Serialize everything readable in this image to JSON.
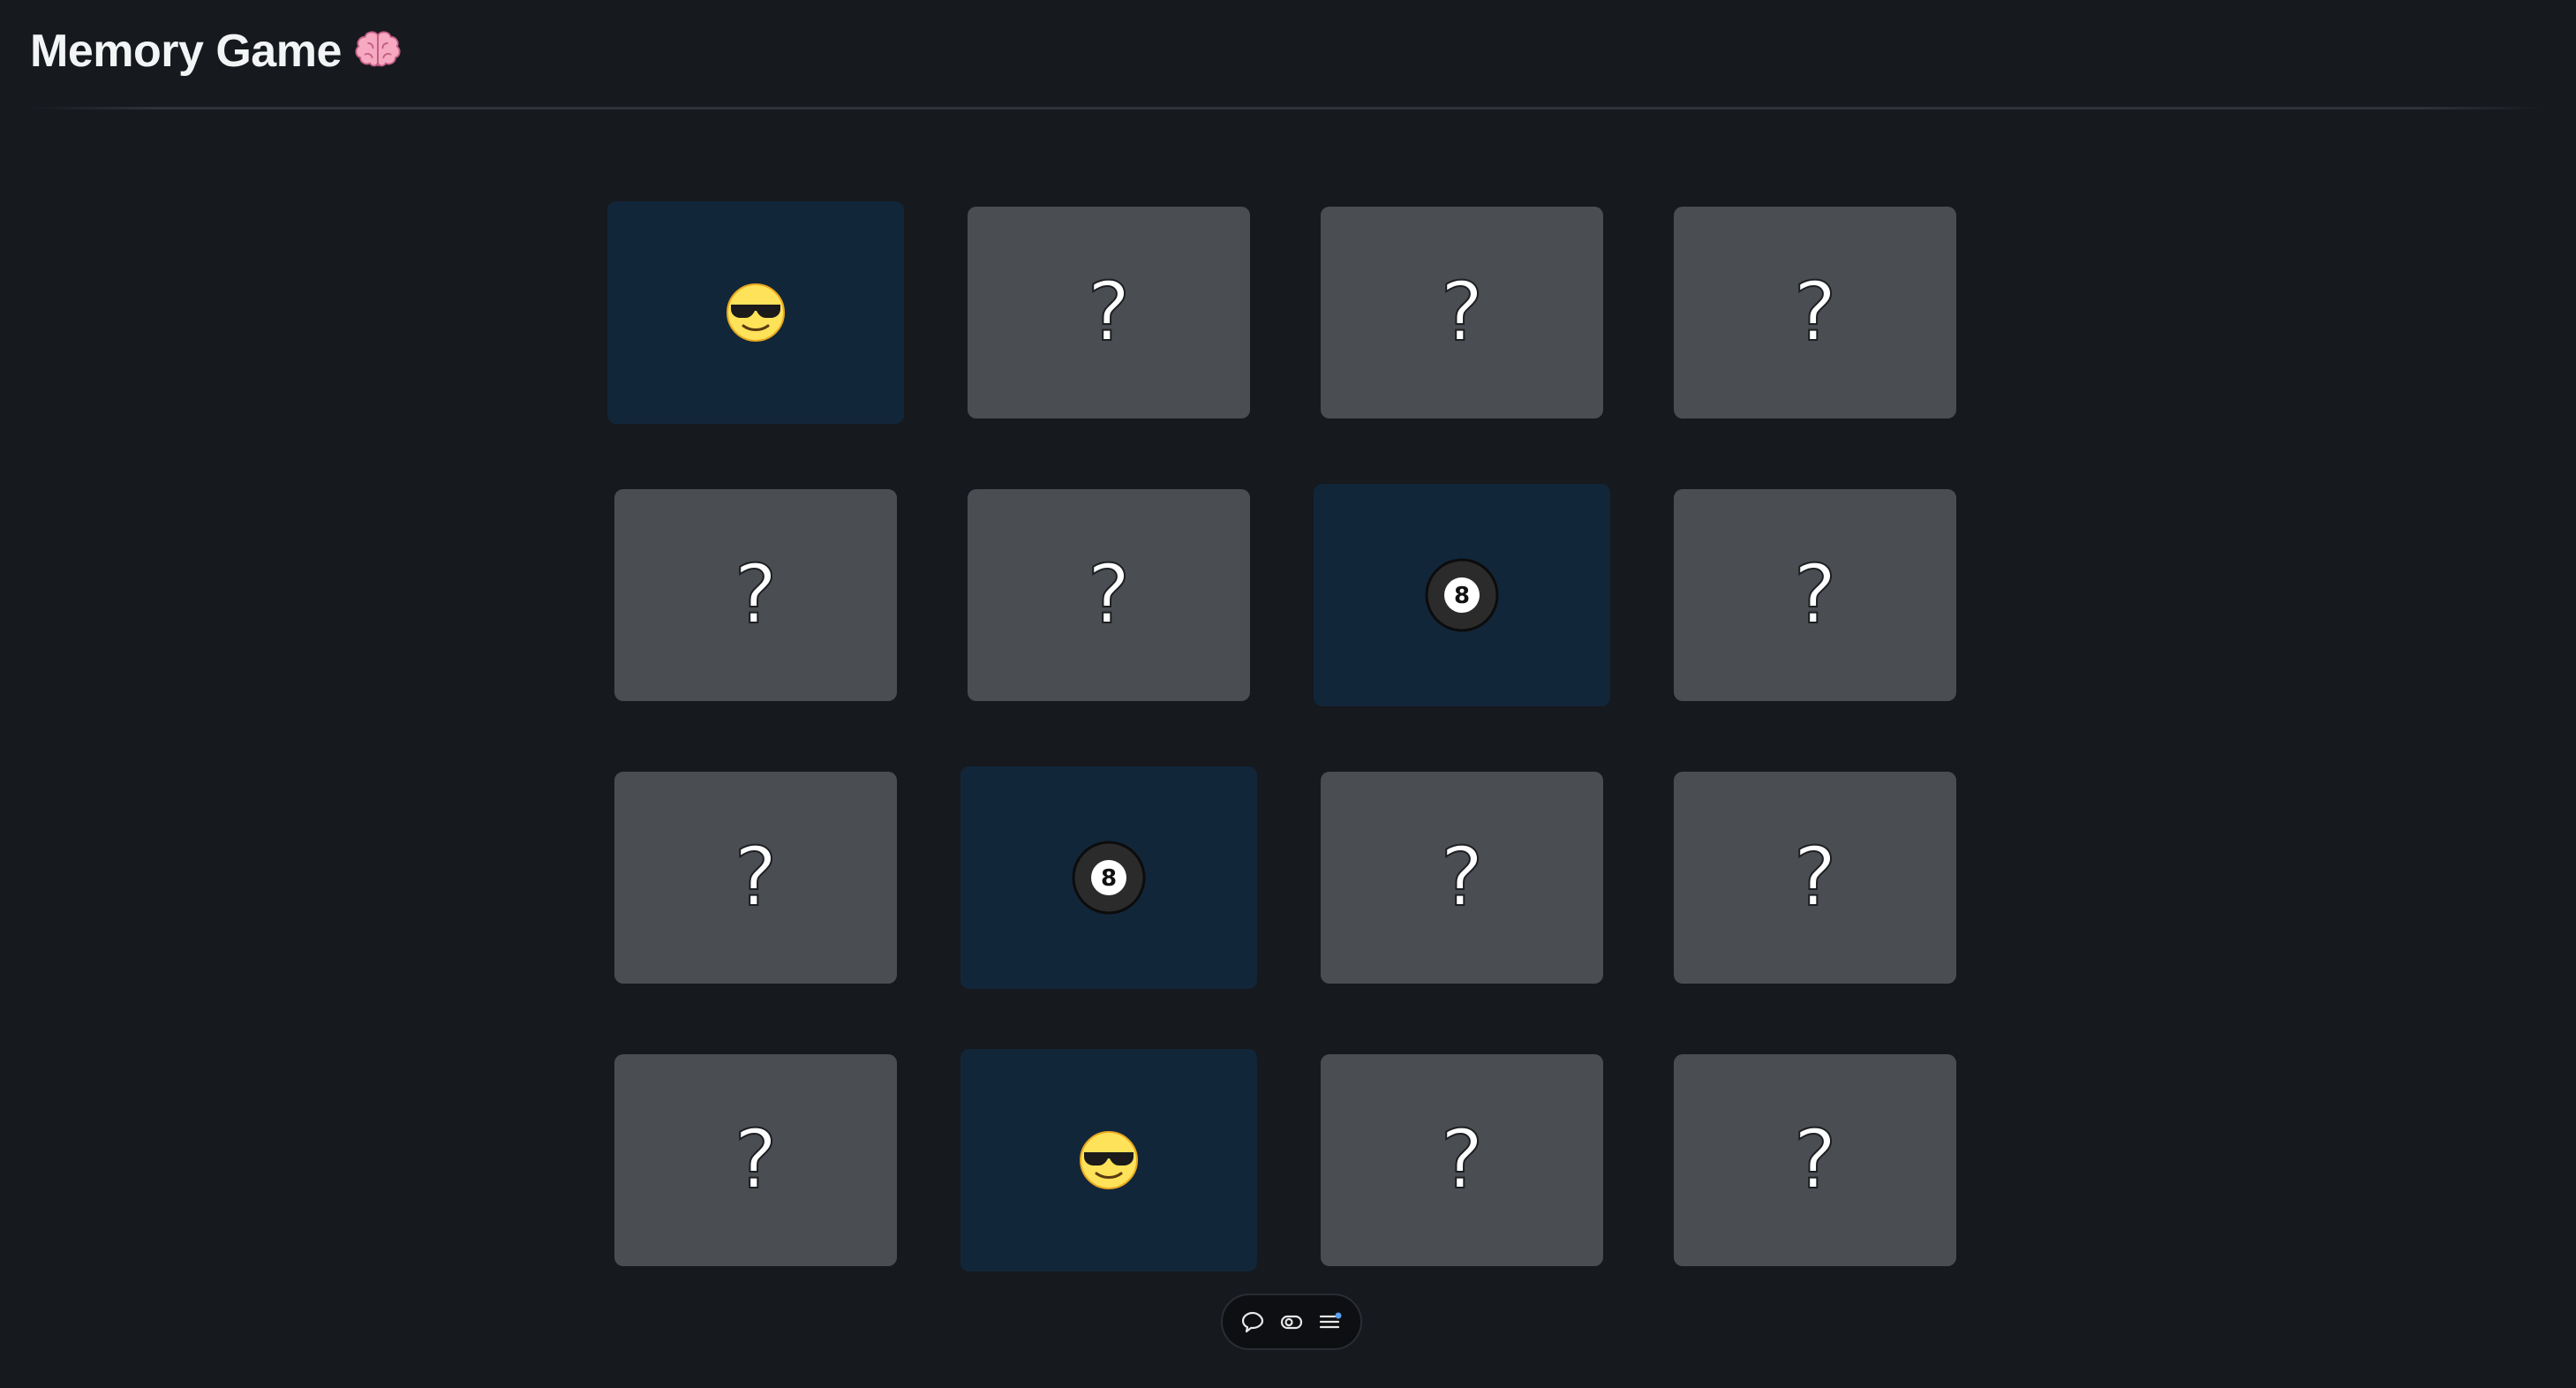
{
  "app": {
    "title": "Memory Game",
    "title_icon": "brain-icon"
  },
  "board": {
    "rows": 4,
    "columns": 4,
    "hidden_symbol": "?",
    "cards": [
      {
        "state": "revealed",
        "icon": "sunglasses-face-icon"
      },
      {
        "state": "hidden"
      },
      {
        "state": "hidden"
      },
      {
        "state": "hidden"
      },
      {
        "state": "hidden"
      },
      {
        "state": "hidden"
      },
      {
        "state": "revealed",
        "icon": "eight-ball-icon"
      },
      {
        "state": "hidden"
      },
      {
        "state": "hidden"
      },
      {
        "state": "revealed",
        "icon": "eight-ball-icon"
      },
      {
        "state": "hidden"
      },
      {
        "state": "hidden"
      },
      {
        "state": "hidden"
      },
      {
        "state": "revealed",
        "icon": "sunglasses-face-icon"
      },
      {
        "state": "hidden"
      },
      {
        "state": "hidden"
      }
    ]
  },
  "toolbar": {
    "buttons": [
      {
        "icon": "comment-icon"
      },
      {
        "icon": "toggle-icon"
      },
      {
        "icon": "menu-icon"
      }
    ]
  },
  "colors": {
    "background": "#16191e",
    "card_hidden": "#4a4e53",
    "card_revealed": "#12263a",
    "text": "#f3f4f6"
  }
}
